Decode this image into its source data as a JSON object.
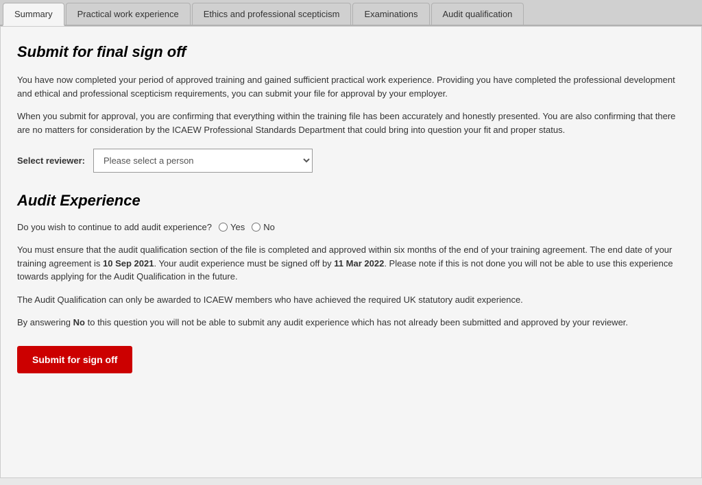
{
  "tabs": [
    {
      "id": "summary",
      "label": "Summary",
      "active": true
    },
    {
      "id": "practical",
      "label": "Practical work experience",
      "active": false
    },
    {
      "id": "ethics",
      "label": "Ethics and professional scepticism",
      "active": false
    },
    {
      "id": "examinations",
      "label": "Examinations",
      "active": false
    },
    {
      "id": "audit",
      "label": "Audit qualification",
      "active": false
    }
  ],
  "page": {
    "main_title": "Submit for final sign off",
    "description1": "You have now completed your period of approved training and gained sufficient practical work experience. Providing you have completed the professional development and ethical and professional scepticism requirements, you can submit your file for approval by your employer.",
    "description2": "When you submit for approval, you are confirming that everything within the training file has been accurately and honestly presented. You are also confirming that there are no matters for consideration by the ICAEW Professional Standards Department that could bring into question your fit and proper status.",
    "select_reviewer_label": "Select reviewer:",
    "reviewer_placeholder": "Please select a person",
    "audit_section_title": "Audit Experience",
    "audit_question": "Do you wish to continue to add audit experience?",
    "yes_label": "Yes",
    "no_label": "No",
    "audit_info1_pre": "You must ensure that the audit qualification section of the file is completed and approved within six months of the end of your training agreement. The end date of your training agreement is ",
    "audit_end_date": "10 Sep 2021",
    "audit_info1_mid": ". Your audit experience must be signed off by ",
    "audit_signoff_date": "11 Mar 2022",
    "audit_info1_post": ". Please note if this is not done you will not be able to use this experience towards applying for the Audit Qualification in the future.",
    "audit_info2": "The Audit Qualification can only be awarded to ICAEW members who have achieved the required UK statutory audit experience.",
    "audit_info3_pre": "By answering ",
    "audit_info3_no": "No",
    "audit_info3_post": " to this question you will not be able to submit any audit experience which has not already been submitted and approved by your reviewer.",
    "submit_button_label": "Submit for sign off"
  }
}
